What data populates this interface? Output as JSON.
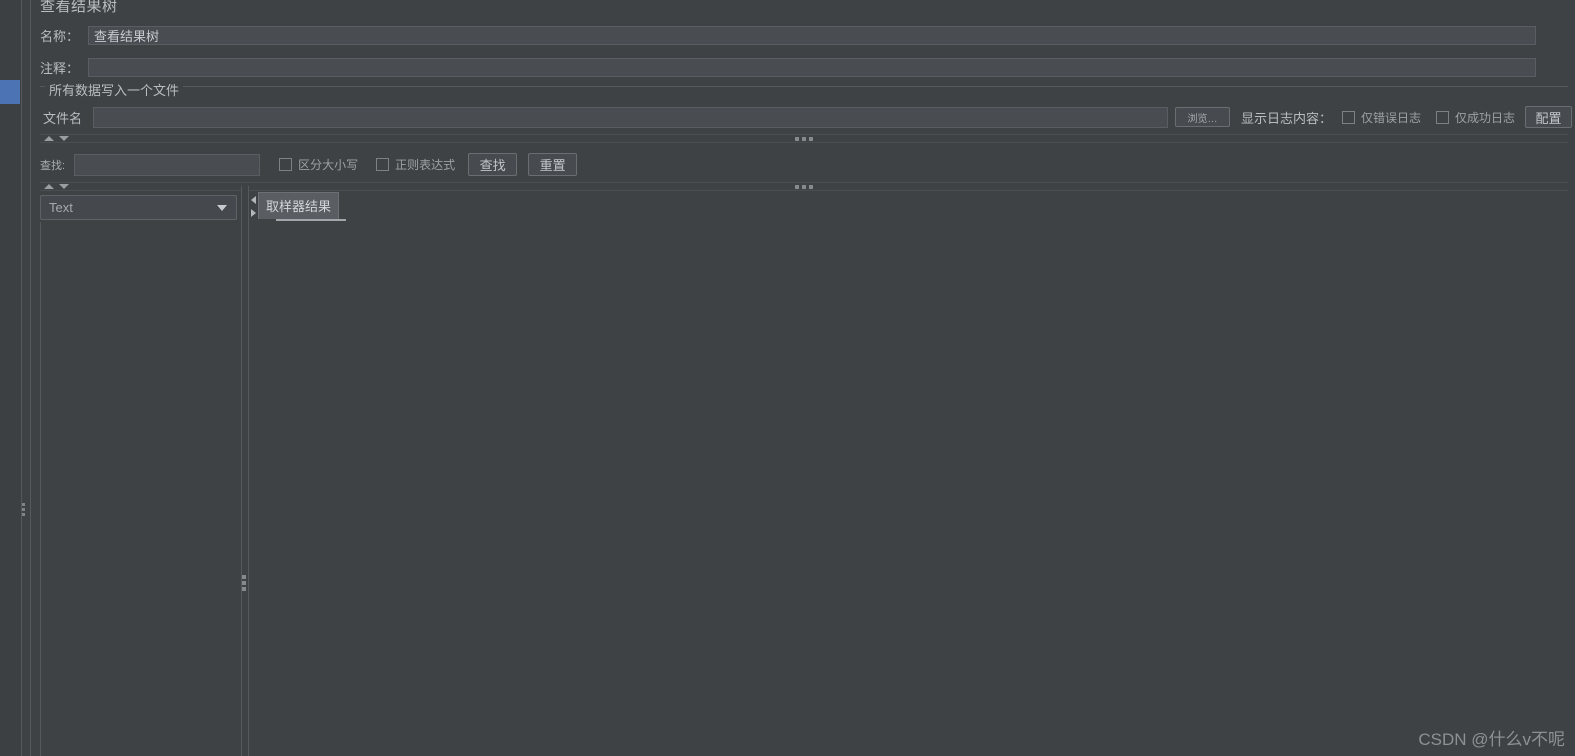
{
  "window": {
    "title": "查看结果树",
    "watermark": "CSDN @什么v不呢"
  },
  "fields": {
    "name_label": "名称：",
    "name_value": "查看结果树",
    "comment_label": "注释：",
    "comment_value": ""
  },
  "file_group": {
    "title": "所有数据写入一个文件",
    "filename_label": "文件名",
    "filename_value": "",
    "browse_button": "浏览…",
    "log_content_label": "显示日志内容：",
    "errors_only_label": "仅错误日志",
    "errors_only_checked": false,
    "success_only_label": "仅成功日志",
    "success_only_checked": false,
    "configure_button": "配置"
  },
  "search_bar": {
    "find_label": "查找:",
    "find_value": "",
    "case_sensitive_label": "区分大小写",
    "case_sensitive_checked": false,
    "regex_label": "正则表达式",
    "regex_checked": false,
    "search_button": "查找",
    "reset_button": "重置"
  },
  "viewer": {
    "renderer_selected": "Text",
    "tab_label": "取样器结果"
  },
  "colors": {
    "background": "#3e4245",
    "field_bg": "#494d51",
    "accent_selection": "#4c73b4",
    "border": "#55595c",
    "text": "#b9bdc1"
  }
}
